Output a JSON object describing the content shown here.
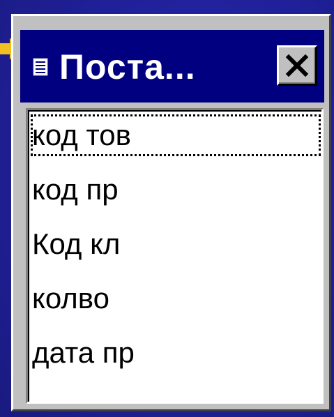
{
  "window": {
    "title": "Поста...",
    "close_label": "X"
  },
  "fields": {
    "items": [
      {
        "label": "код тов",
        "focused": true
      },
      {
        "label": "код пр"
      },
      {
        "label": "Код кл"
      },
      {
        "label": "колво"
      },
      {
        "label": "дата пр"
      }
    ]
  },
  "colors": {
    "slide_background": "#22229a",
    "titlebar": "#000080",
    "window_face": "#c0c0c0",
    "pointer_arrow": "#f0c020"
  },
  "icons": {
    "title": "table-document-icon",
    "close": "close-icon",
    "pointer": "arrow-pointer-icon"
  }
}
